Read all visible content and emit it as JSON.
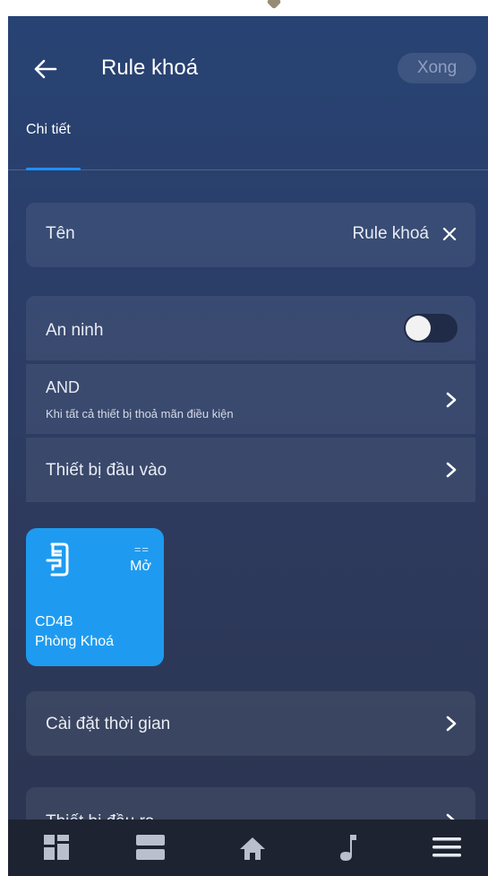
{
  "header": {
    "title": "Rule khoá",
    "done_label": "Xong"
  },
  "tabs": [
    {
      "label": "Chi tiết",
      "active": true
    }
  ],
  "name_row": {
    "label": "Tên",
    "value": "Rule khoá"
  },
  "security_row": {
    "label": "An ninh",
    "toggle_on": false
  },
  "logic_row": {
    "title": "AND",
    "subtitle": "Khi tất cả thiết bị thoả mãn điều kiện"
  },
  "input_row": {
    "label": "Thiết bị đầu vào"
  },
  "device_tile": {
    "operator": "==",
    "state": "Mở",
    "device": "CD4B",
    "room": "Phòng Khoá",
    "color": "#1e9bf0",
    "icon": "door-lock-icon"
  },
  "time_row": {
    "label": "Cài đặt thời gian"
  },
  "output_row": {
    "label": "Thiết bị đầu ra"
  },
  "bottom_nav": [
    {
      "icon": "dashboard-icon"
    },
    {
      "icon": "rooms-icon"
    },
    {
      "icon": "home-icon"
    },
    {
      "icon": "music-icon"
    },
    {
      "icon": "menu-icon"
    }
  ],
  "colors": {
    "accent": "#1e90ff",
    "background_top": "#274374",
    "background_bottom": "#2c3550",
    "nav_bar": "#1d2331"
  }
}
